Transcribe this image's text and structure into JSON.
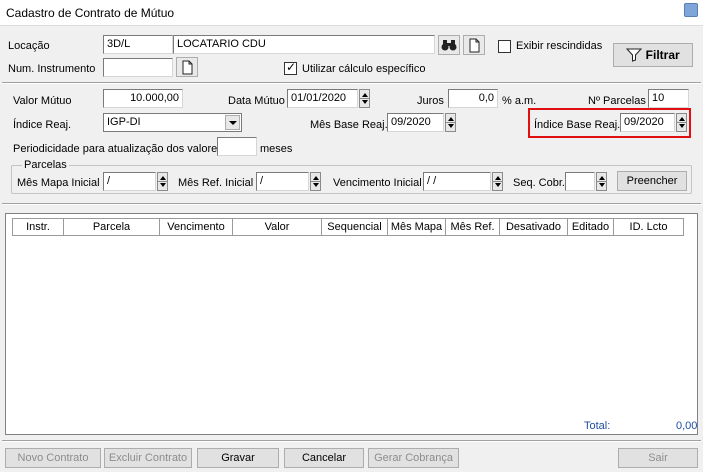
{
  "window": {
    "title": "Cadastro de Contrato de Mútuo"
  },
  "filters": {
    "locacao_label": "Locação",
    "locacao_code": "3D/L",
    "locacao_name": "LOCATARIO CDU",
    "num_instrumento_label": "Num. Instrumento",
    "num_instrumento_value": "",
    "exibir_rescindidas_label": "Exibir rescindidas",
    "exibir_rescindidas_checked": false,
    "utilizar_calculo_label": "Utilizar cálculo específico",
    "utilizar_calculo_checked": true,
    "filtrar_label": "Filtrar"
  },
  "contract": {
    "valor_mutuo_label": "Valor Mútuo",
    "valor_mutuo_value": "10.000,00",
    "data_mutuo_label": "Data Mútuo",
    "data_mutuo_value": "01/01/2020",
    "juros_label": "Juros",
    "juros_value": "0,0",
    "juros_unit": "% a.m.",
    "n_parcelas_label": "Nº Parcelas",
    "n_parcelas_value": "10",
    "indice_reaj_label": "Índice Reaj.",
    "indice_reaj_value": "IGP-DI",
    "mes_base_reaj_label": "Mês Base Reaj.",
    "mes_base_reaj_value": "09/2020",
    "indice_base_reaj_label": "Índice Base Reaj.",
    "indice_base_reaj_value": "09/2020",
    "periodicidade_label": "Periodicidade para atualização dos valores",
    "periodicidade_value": "",
    "periodicidade_unit": "meses"
  },
  "parcelas": {
    "group_label": "Parcelas",
    "mes_mapa_label": "Mês Mapa Inicial",
    "mes_mapa_value": "/",
    "mes_ref_label": "Mês Ref. Inicial",
    "mes_ref_value": "/",
    "vencimento_label": "Vencimento Inicial",
    "vencimento_value": "/ /",
    "seq_cobr_label": "Seq. Cobr.",
    "seq_cobr_value": "",
    "preencher_label": "Preencher"
  },
  "grid": {
    "columns": [
      "Instr.",
      "Parcela",
      "Vencimento",
      "Valor",
      "Sequencial",
      "Mês Mapa",
      "Mês Ref.",
      "Desativado",
      "Editado",
      "ID. Lcto"
    ],
    "total_label": "Total:",
    "total_value": "0,00",
    "total_color": "#1f4fa0"
  },
  "footer": {
    "novo_contrato": "Novo Contrato",
    "excluir_contrato": "Excluir Contrato",
    "gravar": "Gravar",
    "cancelar": "Cancelar",
    "gerar_cobranca": "Gerar Cobrança",
    "sair": "Sair"
  },
  "icons": {
    "search": "binoculars-icon",
    "new_doc": "document-icon",
    "filter": "funnel-icon"
  },
  "colors": {
    "highlight": "#e01010"
  }
}
